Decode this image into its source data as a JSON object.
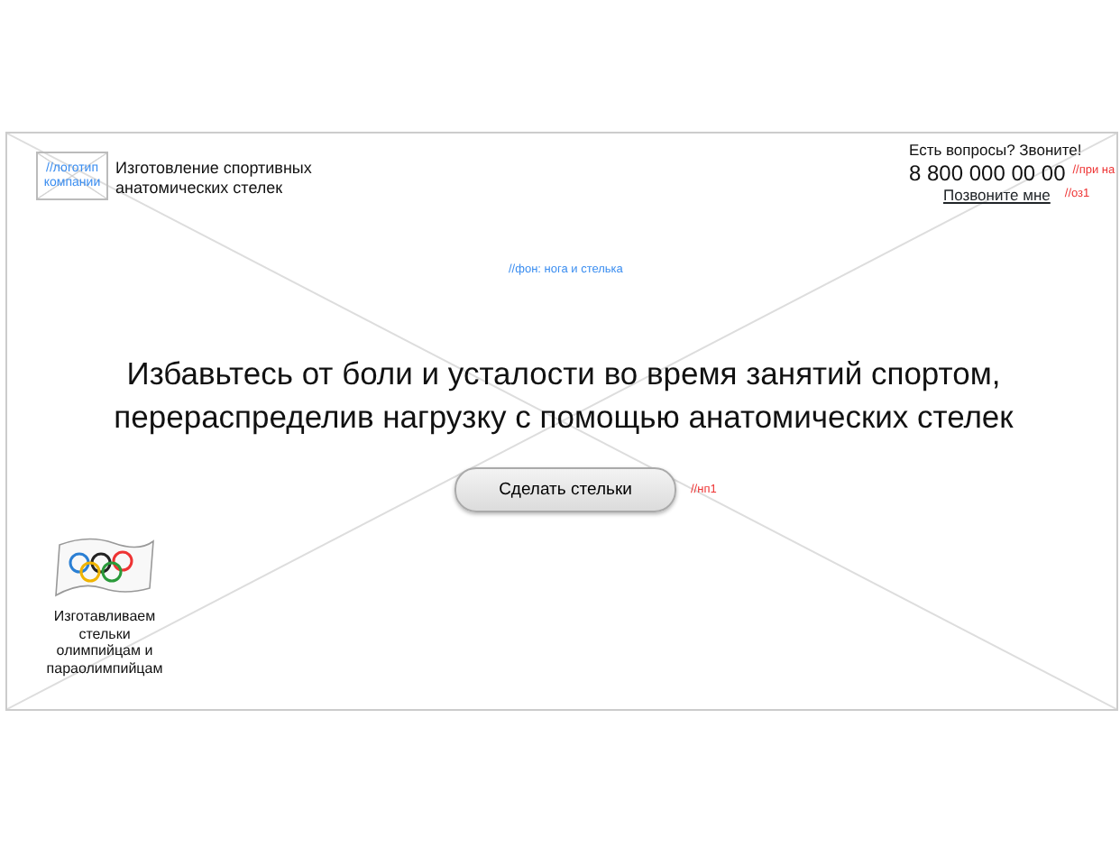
{
  "header": {
    "logo_note": "//логотип компании",
    "tagline": "Изготовление спортивных анатомических стелек",
    "contact": {
      "question": "Есть вопросы? Звоните!",
      "phone": "8 800 000 00 00",
      "phone_note": "//при на",
      "callback_link": "Позвоните мне",
      "callback_note": "//оз1"
    }
  },
  "background_note": "//фон: нога и стелька",
  "hero": {
    "headline": "Избавьтесь от боли и усталости во время занятий спортом, перераспределив нагрузку с помощью анатомических стелек",
    "button": "Сделать стельки",
    "button_note": "//нп1"
  },
  "badge": {
    "caption": "Изготавливаем стельки олимпийцам и параолимпийцам"
  }
}
